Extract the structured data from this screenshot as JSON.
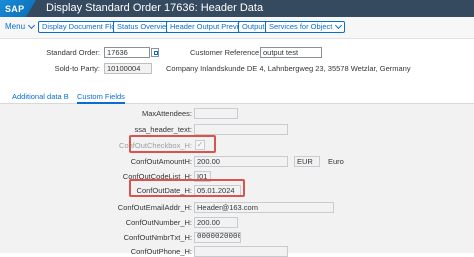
{
  "shell": {
    "logo": "SAP",
    "title": "Display Standard Order 17636: Header Data"
  },
  "toolbar": {
    "menu": "Menu",
    "buttons": [
      "Display Document Flow",
      "Status Overview",
      "Header Output Preview",
      "Output",
      "Services for Object"
    ]
  },
  "header": {
    "standard_order_label": "Standard Order:",
    "standard_order_value": "17636",
    "customer_reference_label": "Customer Reference:",
    "customer_reference_value": "output test",
    "sold_to_label": "Sold-to Party:",
    "sold_to_value": "10100004",
    "sold_to_text": "Company Inlandskunde DE 4, Lahnbergweg 23, 35578 Wetzlar, Germany"
  },
  "tabs": [
    {
      "label": "Additional data B",
      "active": false
    },
    {
      "label": "Custom Fields",
      "active": true
    }
  ],
  "custom_fields": {
    "max_attendees_label": "MaxAttendees:",
    "max_attendees_value": "",
    "ssa_header_text_label": "ssa_header_text:",
    "ssa_header_text_value": "",
    "checkbox_label": "ConfOutCheckbox_H:",
    "checkbox_checked": true,
    "amount_label": "ConfOutAmountH:",
    "amount_value": "200.00",
    "amount_currency": "EUR",
    "amount_currency_text": "Euro",
    "codelist_label": "ConfOutCodeList_H:",
    "codelist_value": "I01",
    "date_label": "ConfOutDate_H:",
    "date_value": "05.01.2024",
    "email_label": "ConfOutEmailAddr_H:",
    "email_value": "Header@163.com",
    "number_label": "ConfOutNumber_H:",
    "number_value": "200.00",
    "nmbr_txt_label": "ConfOutNmbrTxt_H:",
    "nmbr_txt_value": "0000020000",
    "phone_label": "ConfOutPhone_H:",
    "phone_value": ""
  },
  "colors": {
    "shell_bg": "#354a5f",
    "accent": "#0a6ed1",
    "highlight": "#d9534f",
    "panel_bg": "#f2f2f2"
  },
  "icons": [
    "sap-logo",
    "chevron-down-icon",
    "value-help-icon",
    "checkmark-icon"
  ]
}
